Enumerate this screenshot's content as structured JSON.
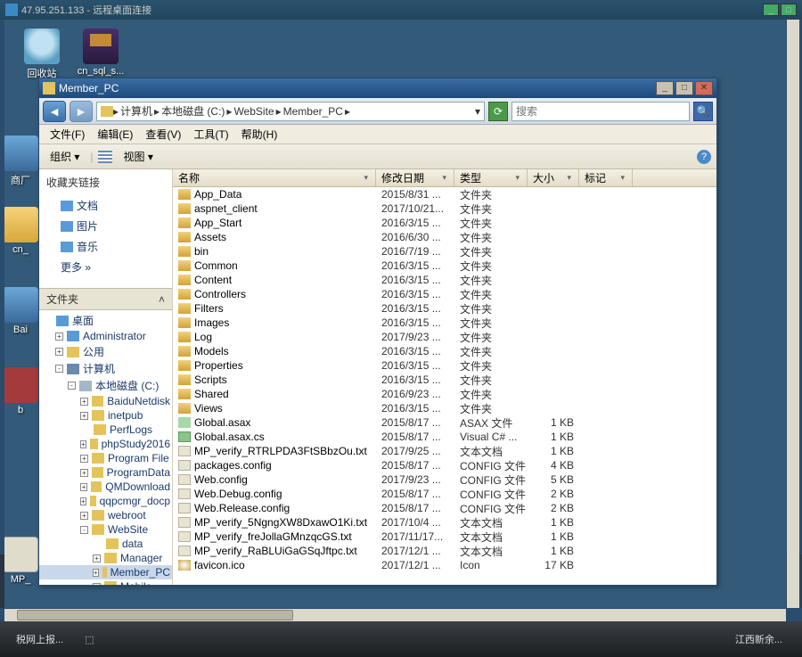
{
  "rdp": {
    "title": "47.95.251.133 - 远程桌面连接"
  },
  "desktop_icons": {
    "recycle": "回收站",
    "rar": "cn_sql_s...",
    "shop": "商厂",
    "cn": "cn_",
    "bai": "Bai",
    "b": "b",
    "mp": "MP_"
  },
  "explorer": {
    "title": "Member_PC",
    "address_segments": [
      "计算机",
      "本地磁盘 (C:)",
      "WebSite",
      "Member_PC"
    ],
    "search_placeholder": "搜索",
    "menubar": [
      "文件(F)",
      "编辑(E)",
      "查看(V)",
      "工具(T)",
      "帮助(H)"
    ],
    "toolbar": {
      "organize": "组织 ▾",
      "view": "视图 ▾"
    },
    "fav_header": "收藏夹链接",
    "favs": [
      "文档",
      "图片",
      "音乐"
    ],
    "fav_more": "更多  »",
    "tree_header": "文件夹",
    "tree": [
      {
        "indent": 0,
        "ex": "",
        "icon": "desk",
        "label": "桌面"
      },
      {
        "indent": 1,
        "ex": "+",
        "icon": "desk",
        "label": "Administrator"
      },
      {
        "indent": 1,
        "ex": "+",
        "icon": "folder",
        "label": "公用"
      },
      {
        "indent": 1,
        "ex": "-",
        "icon": "comp",
        "label": "计算机"
      },
      {
        "indent": 2,
        "ex": "-",
        "icon": "drive",
        "label": "本地磁盘 (C:)"
      },
      {
        "indent": 3,
        "ex": "+",
        "icon": "folder",
        "label": "BaiduNetdisk"
      },
      {
        "indent": 3,
        "ex": "+",
        "icon": "folder",
        "label": "inetpub"
      },
      {
        "indent": 3,
        "ex": "",
        "icon": "folder",
        "label": "PerfLogs"
      },
      {
        "indent": 3,
        "ex": "+",
        "icon": "folder",
        "label": "phpStudy2016"
      },
      {
        "indent": 3,
        "ex": "+",
        "icon": "folder",
        "label": "Program File"
      },
      {
        "indent": 3,
        "ex": "+",
        "icon": "folder",
        "label": "ProgramData"
      },
      {
        "indent": 3,
        "ex": "+",
        "icon": "folder",
        "label": "QMDownload"
      },
      {
        "indent": 3,
        "ex": "+",
        "icon": "folder",
        "label": "qqpcmgr_docp"
      },
      {
        "indent": 3,
        "ex": "+",
        "icon": "folder",
        "label": "webroot"
      },
      {
        "indent": 3,
        "ex": "-",
        "icon": "folder",
        "label": "WebSite"
      },
      {
        "indent": 4,
        "ex": "",
        "icon": "folder",
        "label": "data"
      },
      {
        "indent": 4,
        "ex": "+",
        "icon": "folder",
        "label": "Manager"
      },
      {
        "indent": 4,
        "ex": "+",
        "icon": "folder",
        "label": "Member_PC",
        "sel": true
      },
      {
        "indent": 4,
        "ex": "+",
        "icon": "folder",
        "label": "Mobile"
      }
    ],
    "columns": {
      "name": "名称",
      "date": "修改日期",
      "type": "类型",
      "size": "大小",
      "tag": "标记"
    },
    "files": [
      {
        "ic": "folder",
        "name": "App_Data",
        "date": "2015/8/31 ...",
        "type": "文件夹",
        "size": ""
      },
      {
        "ic": "folder",
        "name": "aspnet_client",
        "date": "2017/10/21...",
        "type": "文件夹",
        "size": ""
      },
      {
        "ic": "folder",
        "name": "App_Start",
        "date": "2016/3/15 ...",
        "type": "文件夹",
        "size": ""
      },
      {
        "ic": "folder",
        "name": "Assets",
        "date": "2016/6/30 ...",
        "type": "文件夹",
        "size": ""
      },
      {
        "ic": "folder",
        "name": "bin",
        "date": "2016/7/19 ...",
        "type": "文件夹",
        "size": ""
      },
      {
        "ic": "folder",
        "name": "Common",
        "date": "2016/3/15 ...",
        "type": "文件夹",
        "size": ""
      },
      {
        "ic": "folder",
        "name": "Content",
        "date": "2016/3/15 ...",
        "type": "文件夹",
        "size": ""
      },
      {
        "ic": "folder",
        "name": "Controllers",
        "date": "2016/3/15 ...",
        "type": "文件夹",
        "size": ""
      },
      {
        "ic": "folder",
        "name": "Filters",
        "date": "2016/3/15 ...",
        "type": "文件夹",
        "size": ""
      },
      {
        "ic": "folder",
        "name": "Images",
        "date": "2016/3/15 ...",
        "type": "文件夹",
        "size": ""
      },
      {
        "ic": "folder",
        "name": "Log",
        "date": "2017/9/23 ...",
        "type": "文件夹",
        "size": ""
      },
      {
        "ic": "folder",
        "name": "Models",
        "date": "2016/3/15 ...",
        "type": "文件夹",
        "size": ""
      },
      {
        "ic": "folder",
        "name": "Properties",
        "date": "2016/3/15 ...",
        "type": "文件夹",
        "size": ""
      },
      {
        "ic": "folder",
        "name": "Scripts",
        "date": "2016/3/15 ...",
        "type": "文件夹",
        "size": ""
      },
      {
        "ic": "folder",
        "name": "Shared",
        "date": "2016/9/23 ...",
        "type": "文件夹",
        "size": ""
      },
      {
        "ic": "folder",
        "name": "Views",
        "date": "2016/3/15 ...",
        "type": "文件夹",
        "size": ""
      },
      {
        "ic": "asax",
        "name": "Global.asax",
        "date": "2015/8/17 ...",
        "type": "ASAX 文件",
        "size": "1 KB"
      },
      {
        "ic": "cs",
        "name": "Global.asax.cs",
        "date": "2015/8/17 ...",
        "type": "Visual C# ...",
        "size": "1 KB"
      },
      {
        "ic": "file",
        "name": "MP_verify_RTRLPDA3FtSBbzOu.txt",
        "date": "2017/9/25 ...",
        "type": "文本文档",
        "size": "1 KB"
      },
      {
        "ic": "file",
        "name": "packages.config",
        "date": "2015/8/17 ...",
        "type": "CONFIG 文件",
        "size": "4 KB"
      },
      {
        "ic": "file",
        "name": "Web.config",
        "date": "2017/9/23 ...",
        "type": "CONFIG 文件",
        "size": "5 KB"
      },
      {
        "ic": "file",
        "name": "Web.Debug.config",
        "date": "2015/8/17 ...",
        "type": "CONFIG 文件",
        "size": "2 KB"
      },
      {
        "ic": "file",
        "name": "Web.Release.config",
        "date": "2015/8/17 ...",
        "type": "CONFIG 文件",
        "size": "2 KB"
      },
      {
        "ic": "file",
        "name": "MP_verify_5NgngXW8DxawO1Ki.txt",
        "date": "2017/10/4 ...",
        "type": "文本文档",
        "size": "1 KB"
      },
      {
        "ic": "file",
        "name": "MP_verify_freJollaGMnzqcGS.txt",
        "date": "2017/11/17...",
        "type": "文本文档",
        "size": "1 KB"
      },
      {
        "ic": "file",
        "name": "MP_verify_RaBLUiGaGSqJftpc.txt",
        "date": "2017/12/1 ...",
        "type": "文本文档",
        "size": "1 KB"
      },
      {
        "ic": "ico",
        "name": "favicon.ico",
        "date": "2017/12/1 ...",
        "type": "Icon",
        "size": "17 KB"
      }
    ]
  },
  "outer_taskbar": {
    "left": "税网上报...",
    "right": "江西新余..."
  }
}
